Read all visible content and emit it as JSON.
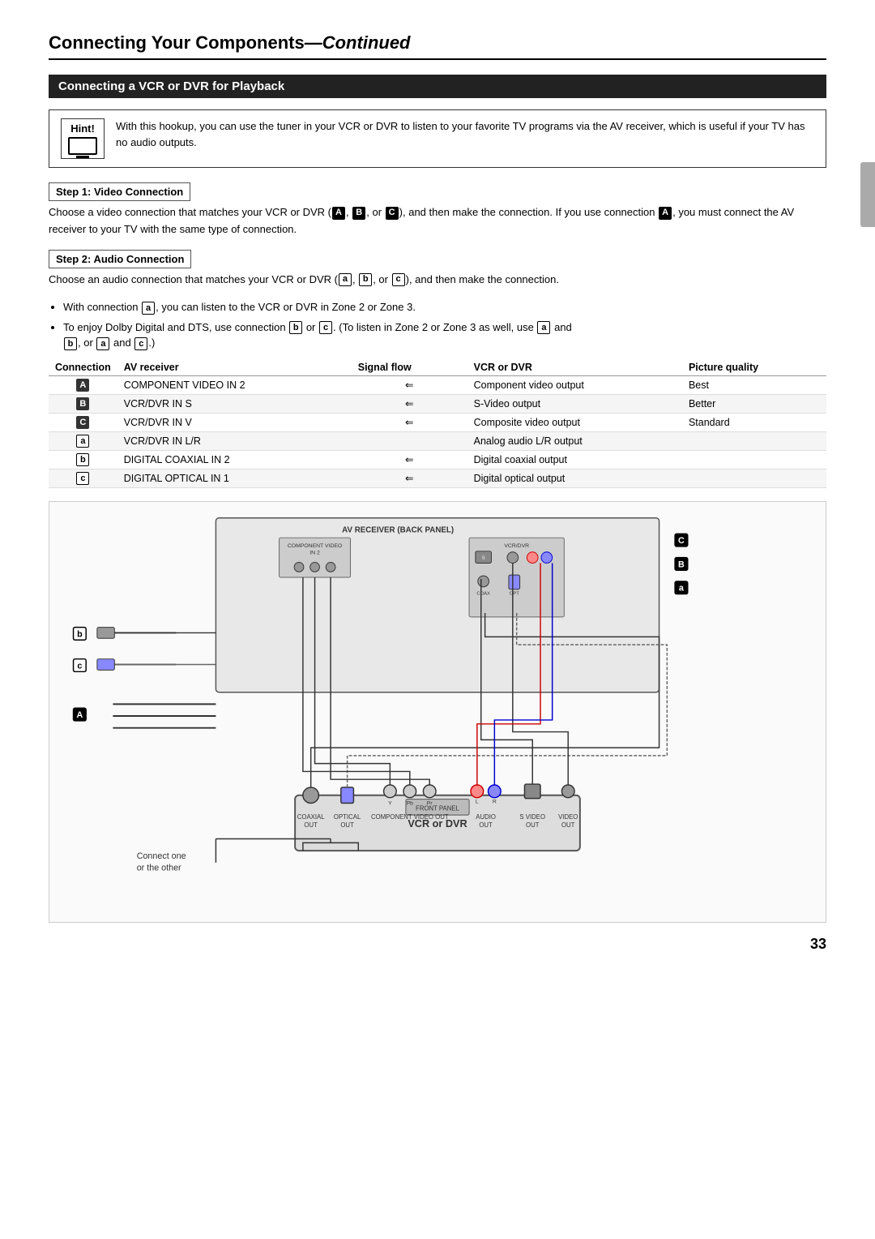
{
  "page": {
    "title_main": "Connecting Your Components",
    "title_italic": "—Continued",
    "section_title": "Connecting a VCR or DVR for Playback",
    "page_number": "33"
  },
  "hint": {
    "label": "Hint!",
    "text": "With this hookup, you can use the tuner in your VCR or DVR to listen to your favorite TV programs via the AV receiver, which is useful if your TV has no audio outputs."
  },
  "step1": {
    "header": "Step 1: Video Connection",
    "text": "Choose a video connection that matches your VCR or DVR (A, B, or C), and then make the connection. If you use connection A, you must connect the AV receiver to your TV with the same type of connection."
  },
  "step2": {
    "header": "Step 2: Audio Connection",
    "text": "Choose an audio connection that matches your VCR or DVR (a, b, or c), and then make the connection."
  },
  "bullets": [
    "With connection a, you can listen to the VCR or DVR in Zone 2 or Zone 3.",
    "To enjoy Dolby Digital and DTS, use connection b or c. (To listen in Zone 2 or Zone 3 as well, use a and b, or a and c.)"
  ],
  "table": {
    "headers": [
      "Connection",
      "AV receiver",
      "Signal flow",
      "VCR or DVR",
      "Picture quality"
    ],
    "rows": [
      {
        "connection": "A",
        "av_receiver": "COMPONENT VIDEO IN 2",
        "signal": "⇐",
        "vcr_dvr": "Component video output",
        "quality": "Best"
      },
      {
        "connection": "B",
        "av_receiver": "VCR/DVR IN S",
        "signal": "⇐",
        "vcr_dvr": "S-Video output",
        "quality": "Better"
      },
      {
        "connection": "C",
        "av_receiver": "VCR/DVR IN V",
        "signal": "⇐",
        "vcr_dvr": "Composite video output",
        "quality": "Standard"
      },
      {
        "connection": "a",
        "av_receiver": "VCR/DVR IN L/R",
        "signal": "",
        "vcr_dvr": "Analog audio L/R output",
        "quality": ""
      },
      {
        "connection": "b",
        "av_receiver": "DIGITAL COAXIAL IN 2",
        "signal": "⇐",
        "vcr_dvr": "Digital coaxial output",
        "quality": ""
      },
      {
        "connection": "c",
        "av_receiver": "DIGITAL OPTICAL IN 1",
        "signal": "⇐",
        "vcr_dvr": "Digital optical output",
        "quality": ""
      }
    ]
  },
  "diagram": {
    "labels": {
      "connect_one_other": "Connect one\nor the other",
      "coaxial_out": "COAXIAL\nOUT",
      "optical_out": "OPTICAL\nOUT",
      "component_video_out": "COMPONENT VIDEO OUT",
      "audio_out": "AUDIO\nOUT",
      "s_video_out": "S VIDEO\nOUT",
      "video_out": "VIDEO\nOUT",
      "vcr_dvr": "VCR or DVR",
      "pb": "Pb",
      "pr": "Pr",
      "y": "Y",
      "l": "L",
      "r": "R",
      "b_label": "b",
      "c_label": "c",
      "A_label": "A",
      "B_label": "B",
      "C_label": "C",
      "a_label": "a"
    }
  }
}
